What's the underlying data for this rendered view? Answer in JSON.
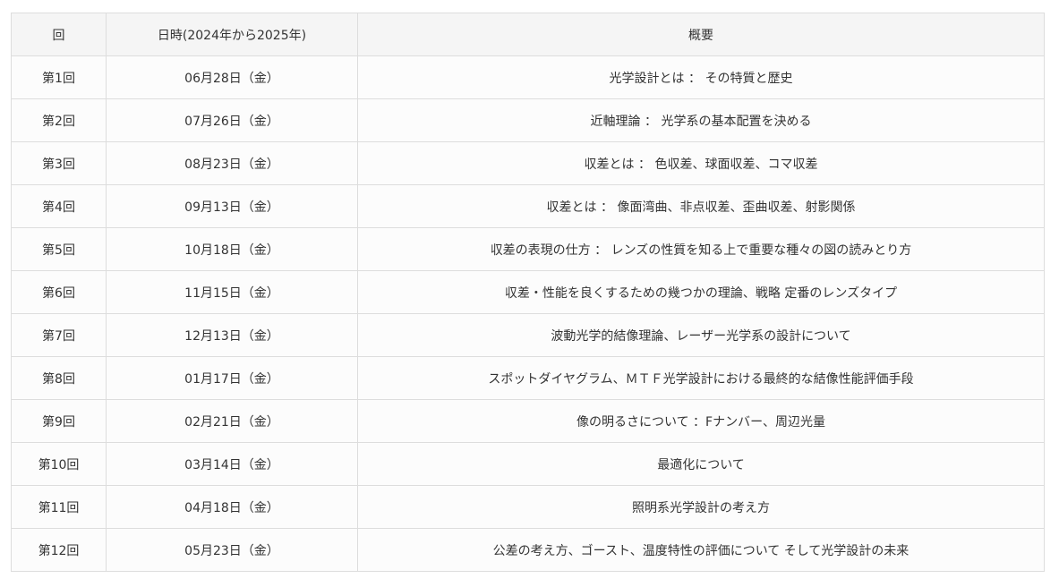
{
  "table": {
    "headers": [
      "回",
      "日時(2024年から2025年)",
      "概要"
    ],
    "rows": [
      {
        "session": "第1回",
        "date": "06月28日（金）",
        "summary": "光学設計とは ： その特質と歴史"
      },
      {
        "session": "第2回",
        "date": "07月26日（金）",
        "summary": "近軸理論 ： 光学系の基本配置を決める"
      },
      {
        "session": "第3回",
        "date": "08月23日（金）",
        "summary": "収差とは ： 色収差、球面収差、コマ収差"
      },
      {
        "session": "第4回",
        "date": "09月13日（金）",
        "summary": "収差とは ： 像面湾曲、非点収差、歪曲収差、射影関係"
      },
      {
        "session": "第5回",
        "date": "10月18日（金）",
        "summary": "収差の表現の仕方 ： レンズの性質を知る上で重要な種々の図の読みとり方"
      },
      {
        "session": "第6回",
        "date": "11月15日（金）",
        "summary": "収差・性能を良くするための幾つかの理論、戦略 定番のレンズタイプ"
      },
      {
        "session": "第7回",
        "date": "12月13日（金）",
        "summary": "波動光学的結像理論、レーザー光学系の設計について"
      },
      {
        "session": "第8回",
        "date": "01月17日（金）",
        "summary": "スポットダイヤグラム、ＭＴＦ光学設計における最終的な結像性能評価手段"
      },
      {
        "session": "第9回",
        "date": "02月21日（金）",
        "summary": "像の明るさについて ：Fナンバー、周辺光量"
      },
      {
        "session": "第10回",
        "date": "03月14日（金）",
        "summary": "最適化について"
      },
      {
        "session": "第11回",
        "date": "04月18日（金）",
        "summary": "照明系光学設計の考え方"
      },
      {
        "session": "第12回",
        "date": "05月23日（金）",
        "summary": "公差の考え方、ゴースト、温度特性の評価について そして光学設計の未来"
      }
    ]
  }
}
